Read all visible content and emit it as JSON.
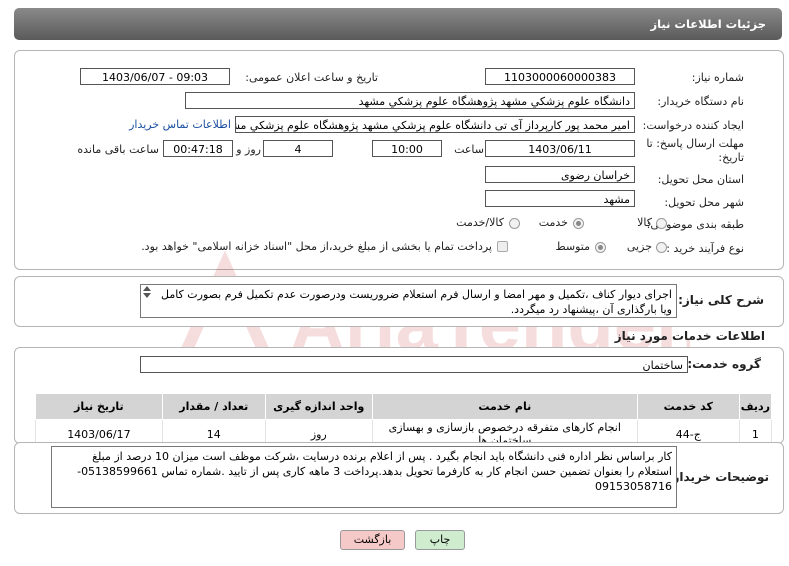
{
  "header": {
    "title": "جزئیات اطلاعات نیاز"
  },
  "form": {
    "need_number_label": "شماره نیاز:",
    "need_number": "1103000060000383",
    "announce_label": "تاریخ و ساعت اعلان عمومی:",
    "announce_value": "1403/06/07 - 09:03",
    "buyer_org_label": "نام دستگاه خریدار:",
    "buyer_org": "دانشگاه علوم پزشکي مشهد   پژوهشگاه علوم پزشکي مشهد",
    "creator_label": "ایجاد کننده درخواست:",
    "creator": "امیر محمد پور کارپرداز آی تی دانشگاه علوم پزشکي مشهد   پژوهشگاه علوم پزشکي مشهد",
    "contact_link": "اطلاعات تماس خریدار",
    "deadline_label_1": "مهلت ارسال پاسخ: تا",
    "deadline_label_2": "تاریخ:",
    "deadline_date": "1403/06/11",
    "time_label": "ساعت",
    "deadline_time": "10:00",
    "days_value": "4",
    "days_label": "روز و",
    "remaining_time": "00:47:18",
    "remaining_label": "ساعت باقی مانده",
    "province_label": "استان محل تحویل:",
    "province": "خراسان رضوی",
    "city_label": "شهر محل تحویل:",
    "city": "مشهد",
    "category_label": "طبقه بندی موضوعی:",
    "category_options": [
      "کالا",
      "خدمت",
      "کالا/خدمت"
    ],
    "category_selected": "خدمت",
    "process_label": "نوع فرآیند خرید :",
    "process_options": [
      "جزیی",
      "متوسط"
    ],
    "process_selected": "متوسط",
    "payment_note": "پرداخت تمام یا بخشی از مبلغ خرید،از محل \"اسناد خزانه اسلامی\" خواهد بود."
  },
  "summary": {
    "label": "شرح کلی نیاز:",
    "text": "اجرای دیوار کناف ،تکمیل و مهر امضا و ارسال فرم استعلام ضروریست ودرصورت عدم تکمیل فرم بصورت کامل ویا بارگذاری آن ،پیشنهاد رد میگردد."
  },
  "services": {
    "section_title": "اطلاعات خدمات مورد نیاز",
    "group_label": "گروه خدمت:",
    "group_value": "ساختمان",
    "columns": [
      "ردیف",
      "کد خدمت",
      "نام خدمت",
      "واحد اندازه گیری",
      "تعداد / مقدار",
      "تاریخ نیاز"
    ],
    "rows": [
      {
        "row": "1",
        "code": "ج-44",
        "name": "انجام کارهای متفرقه درخصوص بازسازی و بهسازی ساختمان ها",
        "unit": "روز",
        "qty": "14",
        "date": "1403/06/17"
      }
    ]
  },
  "buyer_notes": {
    "label": "توضیحات خریدار:",
    "text": "کار براساس نظر اداره فنی دانشگاه باید انجام بگیرد . پس از اعلام برنده درسایت ،شرکت موظف است میزان 10 درصد از مبلغ استعلام را بعنوان تضمین حسن انجام کار به کارفرما تحویل بدهد.پرداخت 3 ماهه کاری پس از تایید .شماره تماس 05138599661-09153058716"
  },
  "buttons": {
    "print": "چاپ",
    "back": "بازگشت"
  },
  "watermark": {
    "text": "AriaTender.neT"
  },
  "colors": {
    "header": "#6e6e6e",
    "link": "#1a4fa0",
    "back_button": "#f6c9c9",
    "print_button": "#cfeccf"
  }
}
